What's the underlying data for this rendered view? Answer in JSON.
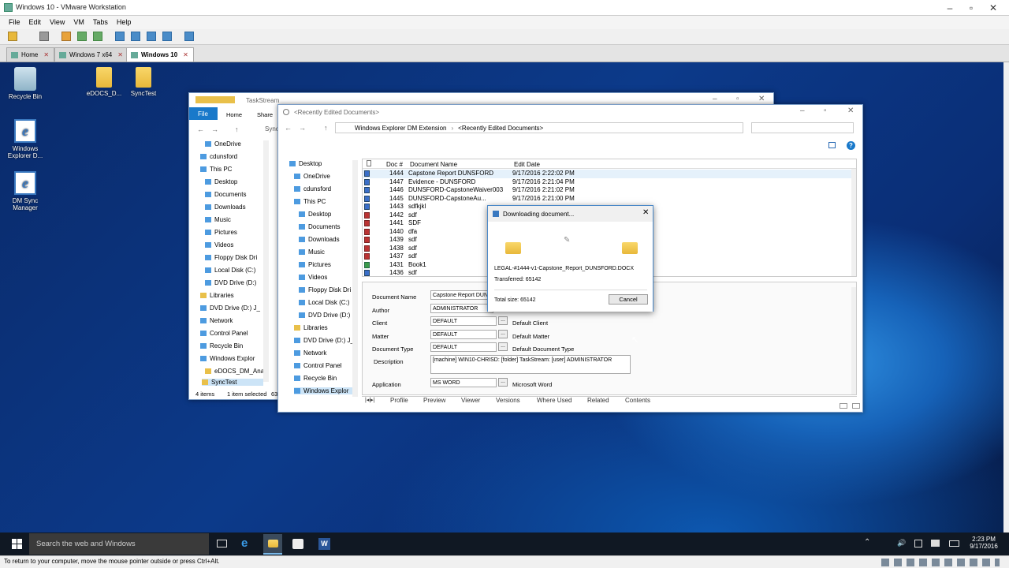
{
  "vm": {
    "title": "Windows 10 - VMware Workstation",
    "menu": [
      "File",
      "Edit",
      "View",
      "VM",
      "Tabs",
      "Help"
    ],
    "tabs": [
      {
        "label": "Home"
      },
      {
        "label": "Windows 7 x64"
      },
      {
        "label": "Windows 10"
      }
    ]
  },
  "desktop_icons": [
    {
      "label": "Recycle Bin"
    },
    {
      "label": "eDOCS_D..."
    },
    {
      "label": "SyncTest"
    },
    {
      "label": "Windows Explorer D..."
    },
    {
      "label": "DM Sync Manager"
    }
  ],
  "explorer1": {
    "title": "TaskStream",
    "ribbon": [
      "File",
      "Home",
      "Share"
    ],
    "path_partial": "Sync",
    "nav": [
      "OneDrive",
      "cdunsford",
      "This PC",
      "Desktop",
      "Documents",
      "Downloads",
      "Music",
      "Pictures",
      "Videos",
      "Floppy Disk Dri",
      "Local Disk (C:)",
      "DVD Drive (D:)",
      "Libraries",
      "DVD Drive (D:) J_",
      "Network",
      "Control Panel",
      "Recycle Bin",
      "Windows Explor",
      "eDOCS_DM_Ana",
      "SyncTest"
    ],
    "status_items": "4 items",
    "status_selected": "1 item selected",
    "status_size": "63"
  },
  "explorer2": {
    "title": "<Recently Edited Documents>",
    "breadcrumb": [
      "Windows Explorer DM Extension",
      "<Recently Edited Documents>"
    ],
    "nav": [
      "Desktop",
      "OneDrive",
      "cdunsford",
      "This PC",
      "Desktop",
      "Documents",
      "Downloads",
      "Music",
      "Pictures",
      "Videos",
      "Floppy Disk Dri",
      "Local Disk (C:)",
      "DVD Drive (D:)",
      "Libraries",
      "DVD Drive (D:) J_",
      "Network",
      "Control Panel",
      "Recycle Bin",
      "Windows Explor"
    ],
    "columns": [
      "Doc #",
      "Document Name",
      "Edit Date"
    ],
    "rows": [
      {
        "doc": "1444",
        "name": "Capstone Report DUNSFORD",
        "date": "9/17/2016 2:22:02 PM"
      },
      {
        "doc": "1447",
        "name": "Evidence - DUNSFORD",
        "date": "9/17/2016 2:21:04 PM"
      },
      {
        "doc": "1446",
        "name": "DUNSFORD-CapstoneWaiver003",
        "date": "9/17/2016 2:21:02 PM"
      },
      {
        "doc": "1445",
        "name": "DUNSFORD-CapstoneAu...",
        "date": "9/17/2016 2:21:00 PM"
      },
      {
        "doc": "1443",
        "name": "sdfkjkl",
        "date": ""
      },
      {
        "doc": "1442",
        "name": "sdf",
        "date": ""
      },
      {
        "doc": "1441",
        "name": "SDF",
        "date": ""
      },
      {
        "doc": "1440",
        "name": "dfa",
        "date": ""
      },
      {
        "doc": "1439",
        "name": "sdf",
        "date": ""
      },
      {
        "doc": "1438",
        "name": "sdf",
        "date": ""
      },
      {
        "doc": "1437",
        "name": "sdf",
        "date": ""
      },
      {
        "doc": "1431",
        "name": "Book1",
        "date": ""
      },
      {
        "doc": "1436",
        "name": "sdf",
        "date": ""
      }
    ],
    "profile": {
      "doc_name_label": "Document Name",
      "doc_name": "Capstone Report DUNS",
      "author_label": "Author",
      "author": "ADMINISTRATOR",
      "client_label": "Client",
      "client": "DEFAULT",
      "client_desc": "Default Client",
      "matter_label": "Matter",
      "matter": "DEFAULT",
      "matter_desc": "Default Matter",
      "type_label": "Document Type",
      "type": "DEFAULT",
      "type_desc": "Default Document Type",
      "desc_label": "Description",
      "desc": "[machine] WIN10-CHRISD: [folder] TaskStream: [user] ADMINISTRATOR",
      "app_label": "Application",
      "app": "MS WORD",
      "app_desc": "Microsoft Word"
    },
    "ptabs": [
      "Profile",
      "Preview",
      "Viewer",
      "Versions",
      "Where Used",
      "Related",
      "Contents"
    ]
  },
  "dialog": {
    "title": "Downloading document...",
    "file": "LEGAL-#1444-v1-Capstone_Report_DUNSFORD.DOCX",
    "transferred": "Transferred: 65142",
    "total": "Total size: 65142",
    "cancel": "Cancel"
  },
  "taskbar": {
    "search": "Search the web and Windows",
    "time": "2:23 PM",
    "date": "9/17/2016"
  },
  "statusbar": "To return to your computer, move the mouse pointer outside or press Ctrl+Alt."
}
